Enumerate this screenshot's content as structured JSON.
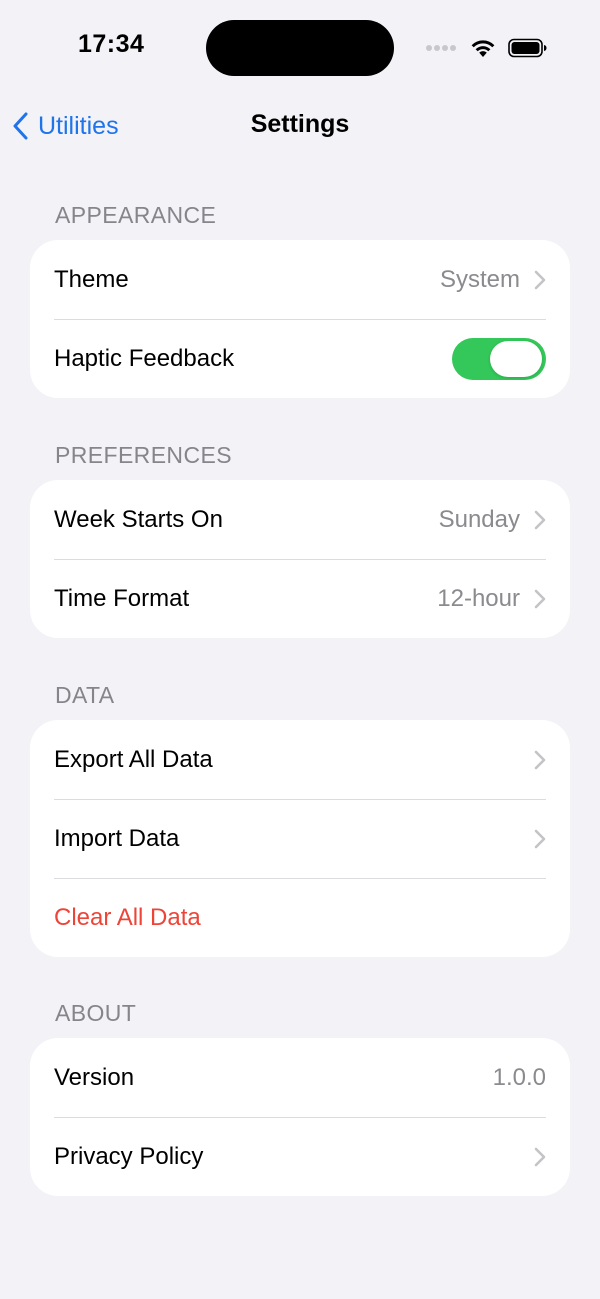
{
  "status_bar": {
    "time": "17:34",
    "icons": [
      "cellular-signal-icon",
      "wifi-icon",
      "battery-icon"
    ]
  },
  "nav": {
    "back_label": "Utilities",
    "title": "Settings",
    "accent_color": "#1e74e8"
  },
  "sections": {
    "appearance": {
      "header": "APPEARANCE",
      "theme": {
        "label": "Theme",
        "value": "System"
      },
      "haptic": {
        "label": "Haptic Feedback",
        "enabled": true,
        "toggle_color": "#34c759"
      }
    },
    "preferences": {
      "header": "PREFERENCES",
      "week_start": {
        "label": "Week Starts On",
        "value": "Sunday"
      },
      "time_format": {
        "label": "Time Format",
        "value": "12-hour"
      }
    },
    "data": {
      "header": "DATA",
      "export": {
        "label": "Export All Data"
      },
      "import": {
        "label": "Import Data"
      },
      "clear": {
        "label": "Clear All Data",
        "color": "#ee4438"
      }
    },
    "about": {
      "header": "ABOUT",
      "version": {
        "label": "Version",
        "value": "1.0.0"
      },
      "privacy": {
        "label": "Privacy Policy"
      }
    }
  }
}
